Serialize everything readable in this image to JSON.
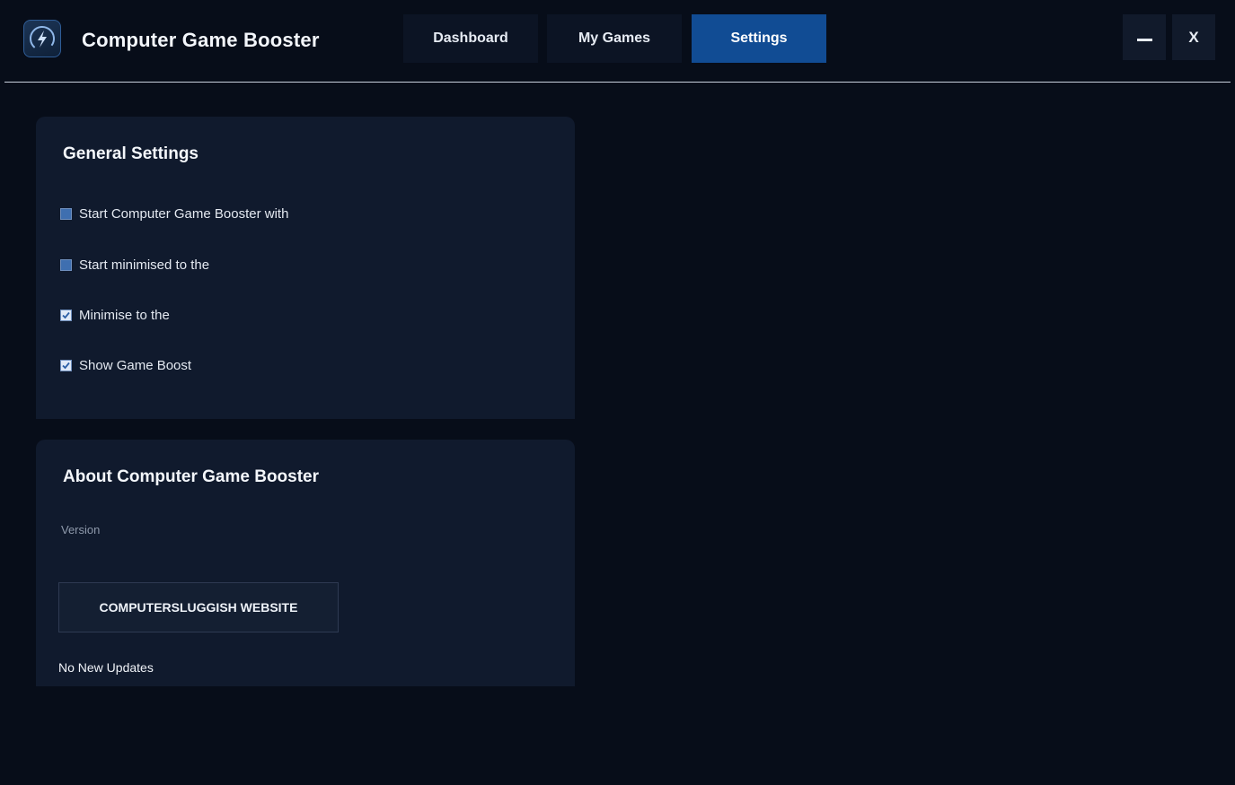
{
  "app": {
    "title": "Computer Game Booster"
  },
  "tabs": [
    {
      "label": "Dashboard",
      "active": false
    },
    {
      "label": "My Games",
      "active": false
    },
    {
      "label": "Settings",
      "active": true
    }
  ],
  "window": {
    "close_label": "X"
  },
  "general": {
    "title": "General Settings",
    "options": [
      {
        "label": "Start Computer Game Booster with",
        "checked": false
      },
      {
        "label": "Start minimised to the",
        "checked": false
      },
      {
        "label": "Minimise to the",
        "checked": true
      },
      {
        "label": "Show Game Boost",
        "checked": true
      }
    ]
  },
  "about": {
    "title": "About Computer Game Booster",
    "version_label": "Version",
    "website_button": "COMPUTERSLUGGISH WEBSITE",
    "update_status": "No New Updates"
  },
  "colors": {
    "background": "#070d19",
    "card": "#101a2d",
    "active_tab": "#114c94"
  },
  "icons": {
    "logo": "speedometer-bolt-icon",
    "check": "checkmark-icon"
  }
}
